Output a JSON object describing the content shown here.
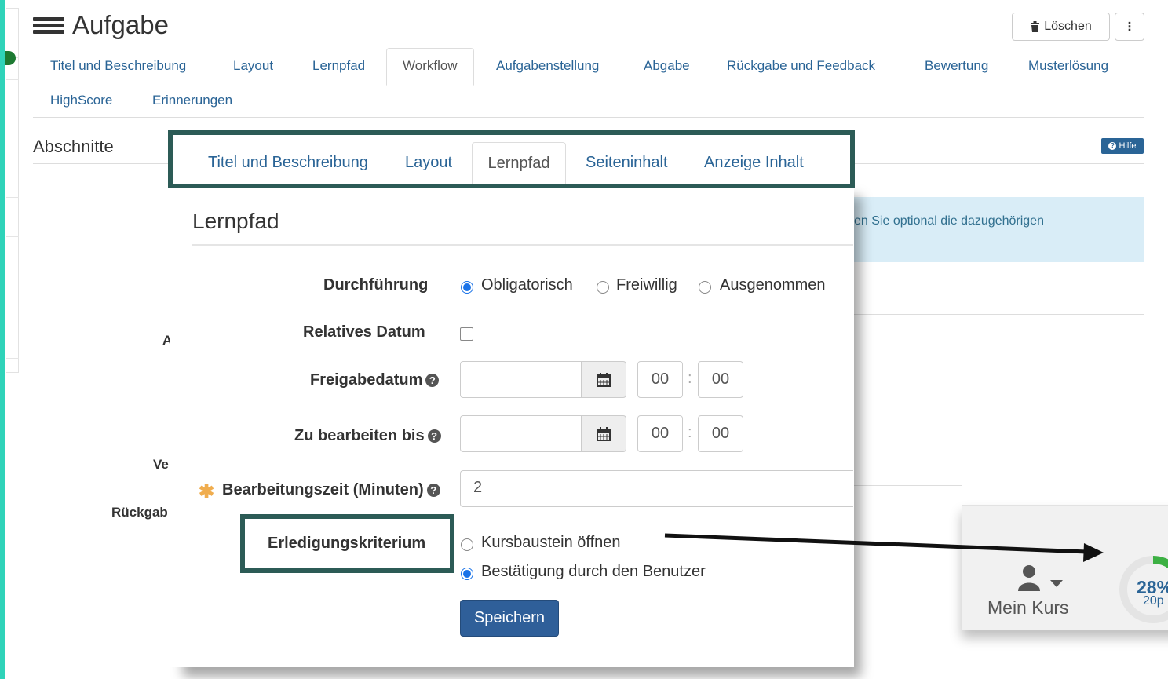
{
  "header": {
    "title": "Aufgabe",
    "delete_label": "Löschen",
    "more_label": "⁝"
  },
  "bg_tabs": [
    "Titel und Beschreibung",
    "Layout",
    "Lernpfad",
    "Workflow",
    "Aufgabenstellung",
    "Abgabe",
    "Rückgabe und Feedback",
    "Bewertung",
    "Musterlösung",
    "HighScore",
    "Erinnerungen"
  ],
  "bg_active_tab": "Workflow",
  "section": {
    "title": "Abschnitte",
    "help_label": "Hilfe",
    "info_text": "en Sie optional die dazugehörigen",
    "frag_a": "A",
    "frag_ve": "Ve",
    "frag_rueckgabe": "Rückgab"
  },
  "dialog": {
    "tabs": [
      "Titel und Beschreibung",
      "Layout",
      "Lernpfad",
      "Seiteninhalt",
      "Anzeige Inhalt"
    ],
    "active_tab": "Lernpfad",
    "heading": "Lernpfad",
    "fields": {
      "durchfuehrung": {
        "label": "Durchführung",
        "options": [
          "Obligatorisch",
          "Freiwillig",
          "Ausgenommen"
        ],
        "selected": "Obligatorisch"
      },
      "relatives_datum": {
        "label": "Relatives Datum",
        "checked": false
      },
      "freigabedatum": {
        "label": "Freigabedatum",
        "date": "",
        "hour": "00",
        "minute": "00"
      },
      "zu_bearbeiten_bis": {
        "label": "Zu bearbeiten bis",
        "date": "",
        "hour": "00",
        "minute": "00"
      },
      "bearbeitungszeit": {
        "label": "Bearbeitungszeit (Minuten)",
        "value": "2",
        "required_marker": "✱"
      },
      "erledigungskriterium": {
        "label": "Erledigungskriterium",
        "options": [
          "Kursbaustein öffnen",
          "Bestätigung durch den Benutzer"
        ],
        "selected": "Bestätigung durch den Benutzer"
      }
    },
    "save_label": "Speichern"
  },
  "mini_widget": {
    "label": "Mein Kurs",
    "progress_percent_text": "28%",
    "progress_fraction": 0.28,
    "points_text": "20p"
  },
  "colors": {
    "link": "#2a6496",
    "highlight_frame": "#2c5b56",
    "primary_button": "#2f5f99",
    "teal_edge": "#2fd3b9",
    "required": "#f0ad4e"
  }
}
